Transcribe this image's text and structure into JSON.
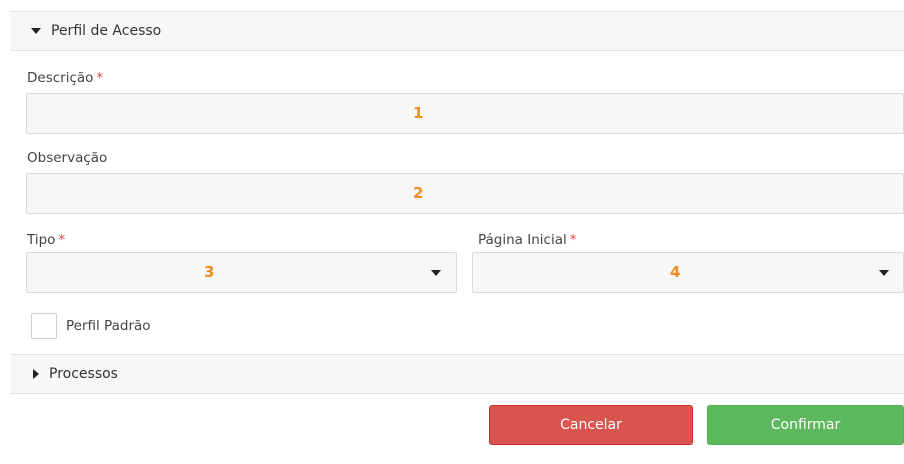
{
  "sections": {
    "access_profile": {
      "title": "Perfil de Acesso",
      "expanded": true
    },
    "processes": {
      "title": "Processos",
      "expanded": false
    }
  },
  "form": {
    "description": {
      "label": "Descrição",
      "required_mark": "*",
      "marker": "1"
    },
    "observation": {
      "label": "Observação",
      "marker": "2"
    },
    "type": {
      "label": "Tipo",
      "required_mark": "*",
      "marker": "3"
    },
    "home_page": {
      "label": "Página Inicial",
      "required_mark": "*",
      "marker": "4"
    },
    "default_profile": {
      "label": "Perfil Padrão",
      "checked": false
    }
  },
  "actions": {
    "cancel_label": "Cancelar",
    "confirm_label": "Confirmar"
  },
  "colors": {
    "marker": "#f28a1e",
    "required": "#e0483f",
    "cancel": "#d9534f",
    "confirm": "#5cb85c"
  }
}
